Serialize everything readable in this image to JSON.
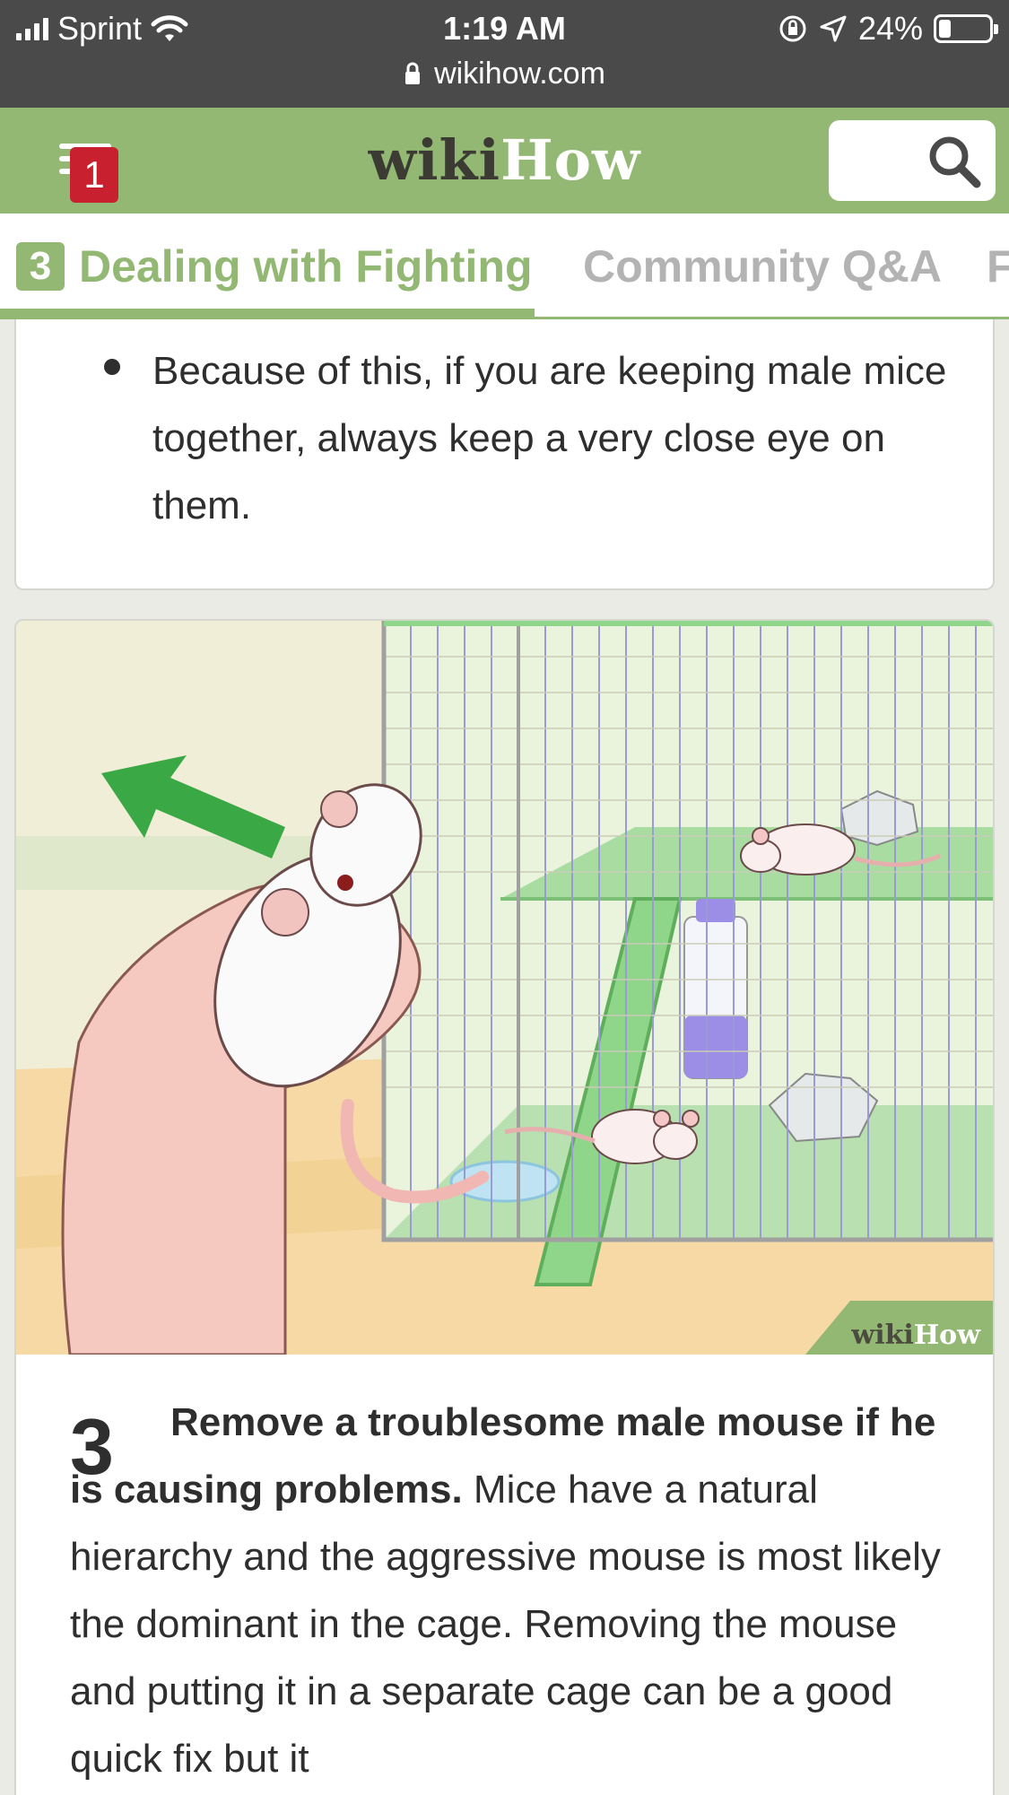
{
  "status_bar": {
    "carrier": "Sprint",
    "time": "1:19 AM",
    "battery": "24%",
    "battery_level": 0.24,
    "url": "wikihow.com"
  },
  "header": {
    "logo_wiki": "wiki",
    "logo_how": "How",
    "menu_badge": "1"
  },
  "tabs": {
    "active_number": "3",
    "active_label": "Dealing with Fighting",
    "second_label": "Community Q&A",
    "third_label_partial": "F"
  },
  "bullet": {
    "text": "Because of this, if you are keeping male mice together, always keep a very close eye on them."
  },
  "step": {
    "number": "3",
    "bold": "Remove a troublesome male mouse if he is causing problems.",
    "text": " Mice have a natural hierarchy and the aggressive mouse is most likely the dominant in the cage. Removing the mouse and putting it in a separate cage can be a good quick fix but it"
  },
  "illustration": {
    "watermark_wiki": "wiki",
    "watermark_how": "How"
  },
  "colors": {
    "brand_green": "#93b874",
    "badge_red": "#c8202e",
    "status_bar": "#4a4a4a",
    "arrow_green": "#3aa845"
  }
}
